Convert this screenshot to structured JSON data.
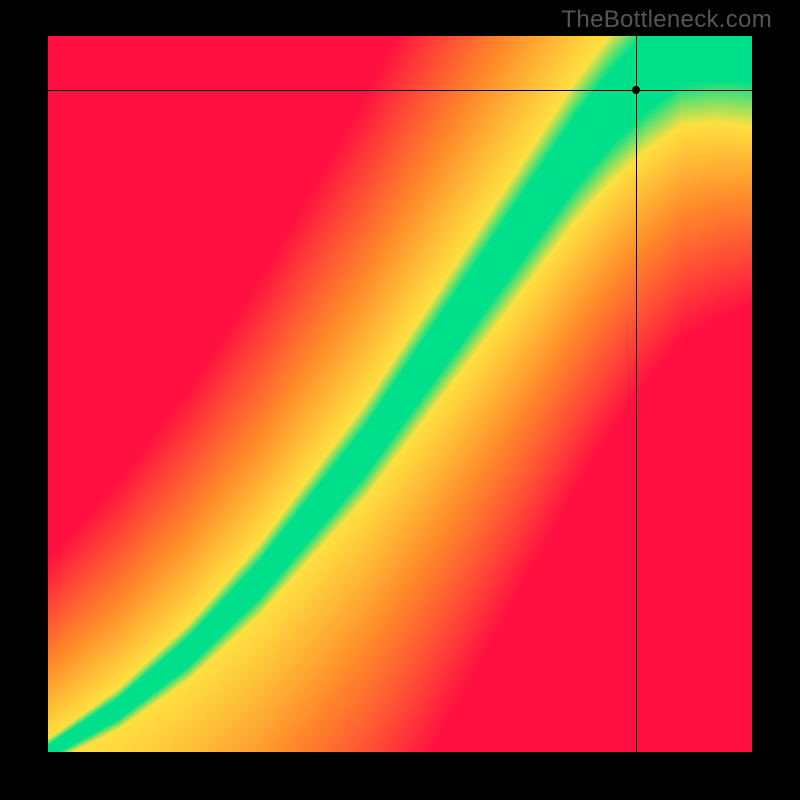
{
  "watermark": "TheBottleneck.com",
  "chart_data": {
    "type": "heatmap",
    "title": "",
    "xlabel": "",
    "ylabel": "",
    "xlim": [
      0,
      1
    ],
    "ylim": [
      0,
      1
    ],
    "marker": {
      "x": 0.835,
      "y": 0.925
    },
    "crosshair": {
      "x": 0.835,
      "y": 0.925
    },
    "ridge_curve": [
      {
        "x": 0.0,
        "y": 0.0
      },
      {
        "x": 0.05,
        "y": 0.03
      },
      {
        "x": 0.1,
        "y": 0.06
      },
      {
        "x": 0.15,
        "y": 0.1
      },
      {
        "x": 0.2,
        "y": 0.14
      },
      {
        "x": 0.25,
        "y": 0.19
      },
      {
        "x": 0.3,
        "y": 0.24
      },
      {
        "x": 0.35,
        "y": 0.3
      },
      {
        "x": 0.4,
        "y": 0.36
      },
      {
        "x": 0.45,
        "y": 0.42
      },
      {
        "x": 0.5,
        "y": 0.49
      },
      {
        "x": 0.55,
        "y": 0.56
      },
      {
        "x": 0.6,
        "y": 0.63
      },
      {
        "x": 0.65,
        "y": 0.7
      },
      {
        "x": 0.7,
        "y": 0.77
      },
      {
        "x": 0.75,
        "y": 0.84
      },
      {
        "x": 0.8,
        "y": 0.9
      },
      {
        "x": 0.85,
        "y": 0.95
      },
      {
        "x": 0.9,
        "y": 0.99
      },
      {
        "x": 0.95,
        "y": 1.0
      }
    ],
    "color_stops": {
      "ridge": "#00e08a",
      "mid": "#ffe040",
      "middle": "#ff8a2a",
      "far": "#ff1040"
    },
    "ridge_width_frac": 0.06,
    "transition_width_frac": 0.12
  }
}
